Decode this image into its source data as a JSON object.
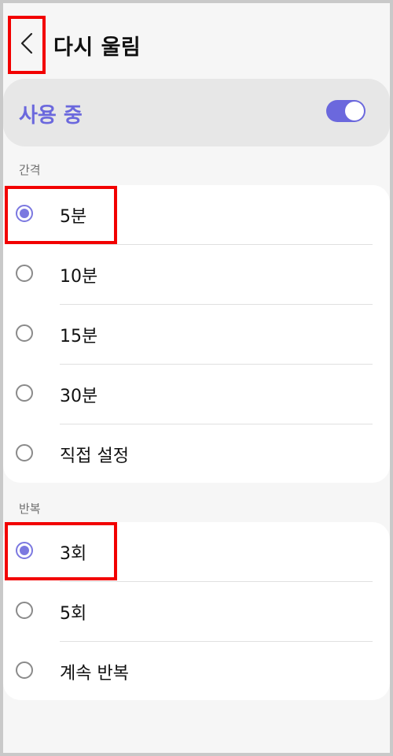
{
  "header": {
    "title": "다시 울림",
    "back_icon": "chevron-left-icon"
  },
  "master_switch": {
    "label": "사용 중",
    "on": true,
    "accent_color": "#6b68dd"
  },
  "interval": {
    "section_label": "간격",
    "options": [
      {
        "label": "5분",
        "selected": true
      },
      {
        "label": "10분",
        "selected": false
      },
      {
        "label": "15분",
        "selected": false
      },
      {
        "label": "30분",
        "selected": false
      },
      {
        "label": "직접 설정",
        "selected": false
      }
    ]
  },
  "repeat": {
    "section_label": "반복",
    "options": [
      {
        "label": "3회",
        "selected": true
      },
      {
        "label": "5회",
        "selected": false
      },
      {
        "label": "계속 반복",
        "selected": false
      }
    ]
  },
  "colors": {
    "background": "#f6f6f6",
    "card": "#ffffff",
    "master_card": "#e7e7e7",
    "radio_selected": "#7b78e0",
    "highlight": "#f20000"
  }
}
